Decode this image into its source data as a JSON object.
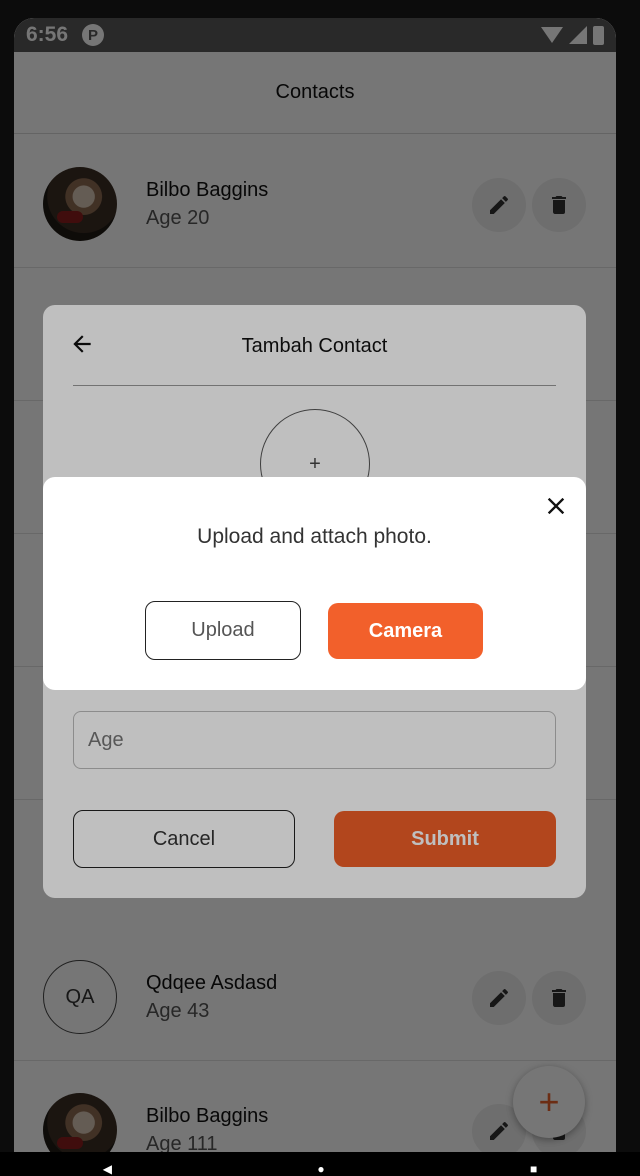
{
  "status_bar": {
    "time": "6:56",
    "notification_icon": "p-icon"
  },
  "app_bar": {
    "title": "Contacts"
  },
  "contacts": [
    {
      "name": "Bilbo Baggins",
      "age": "Age 20",
      "avatar": "photo"
    },
    {
      "name": "Qdqee Asdasd",
      "age": "Age 43",
      "avatar": "initials",
      "initials": "QA"
    },
    {
      "name": "Bilbo Baggins",
      "age": "Age 111",
      "avatar": "photo"
    }
  ],
  "tambah_dialog": {
    "title": "Tambah Contact",
    "photo_placeholder": "+",
    "age_placeholder": "Age",
    "cancel_label": "Cancel",
    "submit_label": "Submit"
  },
  "upload_dialog": {
    "message": "Upload and attach photo.",
    "upload_label": "Upload",
    "camera_label": "Camera"
  },
  "fab": {
    "label": "+"
  },
  "colors": {
    "accent": "#f2602b",
    "status_bar": "#5a5a5a"
  }
}
